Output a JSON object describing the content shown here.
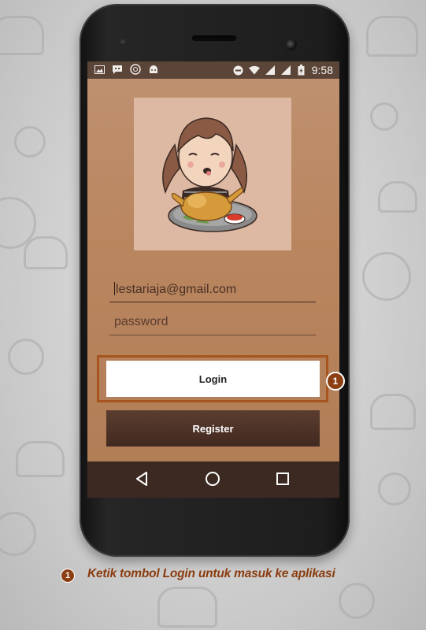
{
  "statusbar": {
    "time": "9:58",
    "icons": [
      "image-icon",
      "chat-icon",
      "ubuntu-icon",
      "android-icon",
      "do-not-disturb-icon",
      "wifi-icon",
      "signal-icon",
      "signal-icon-2",
      "battery-icon"
    ]
  },
  "login_form": {
    "email_value": "lestariaja@gmail.com",
    "password_placeholder": "password",
    "login_label": "Login",
    "register_label": "Register"
  },
  "navbar": {
    "icons": [
      "back-icon",
      "home-icon",
      "recents-icon"
    ]
  },
  "annotation": {
    "step_number": "1",
    "caption": "Ketik tombol Login untuk masuk ke aplikasi"
  },
  "colors": {
    "accent": "#8a3c0e",
    "highlight_border": "#a7541f",
    "screen_bg": "#b9865f",
    "register_bg": "#4a3026"
  }
}
